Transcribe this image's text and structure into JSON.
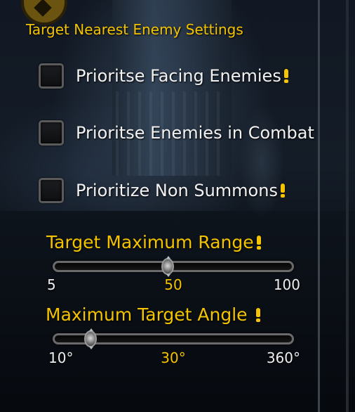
{
  "section": {
    "title": "Target Nearest Enemy Settings"
  },
  "options": [
    {
      "label": "Prioritse Facing Enemies",
      "checked": false,
      "has_info": true
    },
    {
      "label": "Prioritse Enemies in Combat",
      "checked": false,
      "has_info": false
    },
    {
      "label": "Prioritize Non Summons",
      "checked": false,
      "has_info": true
    }
  ],
  "sliders": {
    "range": {
      "label": "Target Maximum Range",
      "min_label": "5",
      "value_label": "50",
      "max_label": "100",
      "min": 5,
      "max": 100,
      "value": 50
    },
    "angle": {
      "label": "Maximum Target Angle",
      "min_label": "10°",
      "value_label": "30°",
      "max_label": "360°",
      "min": 10,
      "max": 360,
      "value": 30
    }
  },
  "icons": {
    "info": "exclamation-info-icon"
  },
  "colors": {
    "accent_gold": "#f3c300",
    "label_white": "#f2f2f2"
  }
}
